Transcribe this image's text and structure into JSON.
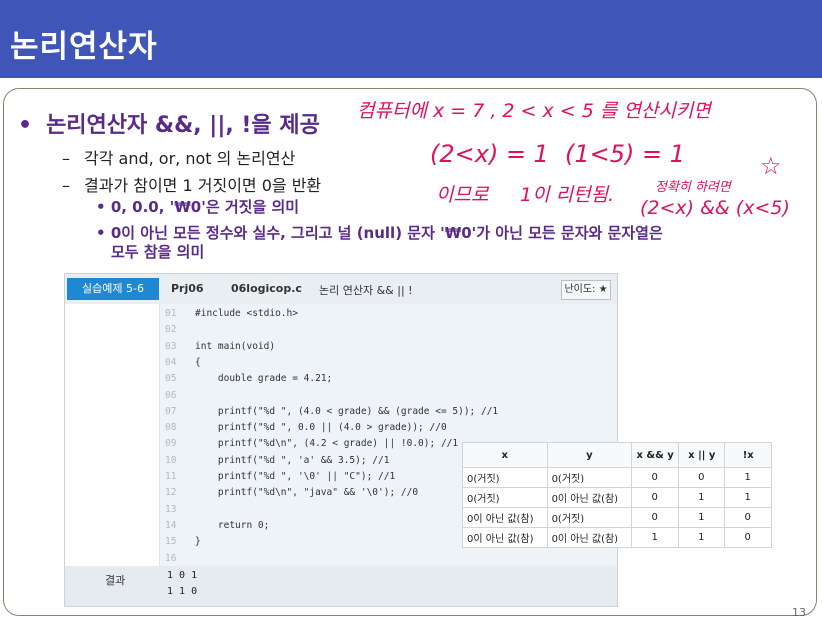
{
  "slide": {
    "title": "논리연산자",
    "bullet_main": "논리연산자 &&, ||, !을 제공",
    "sub_items": [
      "각각 and, or, not 의 논리연산",
      "결과가 참이면 1 거짓이면 0을 반환"
    ],
    "sub_sub_items": [
      "0, 0.0, '₩0'은 거짓을 의미",
      "0이 아닌 모든 정수와 실수, 그리고 널 (null) 문자 '₩0'가 아닌 모든 문자와 문자열은",
      "모두 참을 의미"
    ],
    "page_number": "13"
  },
  "annotations": {
    "line1": "컴퓨터에  x = 7 ,   2 < x < 5  를  연산시키면",
    "line2a": "(2<x) = 1",
    "line2b": "(1<5) = 1",
    "line3a": "이므로",
    "line3b": "1이 리턴됨.",
    "line3c": "정확히 하려면",
    "star": "☆",
    "line4": "(2<x) && (x<5)"
  },
  "code_panel": {
    "badge": "실습예제 5-6",
    "project": "Prj06",
    "filename": "06logicop.c",
    "description": "논리 연산자 && || !",
    "difficulty": "난이도: ★",
    "lines": [
      {
        "no": "01",
        "text": "#include <stdio.h>"
      },
      {
        "no": "02",
        "text": ""
      },
      {
        "no": "03",
        "text": "int main(void)"
      },
      {
        "no": "04",
        "text": "{"
      },
      {
        "no": "05",
        "text": "    double grade = 4.21;"
      },
      {
        "no": "06",
        "text": ""
      },
      {
        "no": "07",
        "text": "    printf(\"%d \", (4.0 < grade) && (grade <= 5)); //1"
      },
      {
        "no": "08",
        "text": "    printf(\"%d \", 0.0 || (4.0 > grade)); //0"
      },
      {
        "no": "09",
        "text": "    printf(\"%d\\n\", (4.2 < grade) || !0.0); //1"
      },
      {
        "no": "10",
        "text": "    printf(\"%d \", 'a' && 3.5); //1"
      },
      {
        "no": "11",
        "text": "    printf(\"%d \", '\\0' || \"C\"); //1"
      },
      {
        "no": "12",
        "text": "    printf(\"%d\\n\", \"java\" && '\\0'); //0"
      },
      {
        "no": "13",
        "text": ""
      },
      {
        "no": "14",
        "text": "    return 0;"
      },
      {
        "no": "15",
        "text": "}"
      },
      {
        "no": "16",
        "text": ""
      }
    ],
    "result_label": "결과",
    "result_lines": [
      "1 0 1",
      "1 1 0"
    ]
  },
  "truth_table": {
    "headers": [
      "x",
      "y",
      "x && y",
      "x || y",
      "!x"
    ],
    "rows": [
      [
        "0(거짓)",
        "0(거짓)",
        "0",
        "0",
        "1"
      ],
      [
        "0(거짓)",
        "0이 아닌 값(참)",
        "0",
        "1",
        "1"
      ],
      [
        "0이 아닌 값(참)",
        "0(거짓)",
        "0",
        "1",
        "0"
      ],
      [
        "0이 아닌 값(참)",
        "0이 아닌 값(참)",
        "1",
        "1",
        "0"
      ]
    ]
  },
  "colors": {
    "title_bar": "#3f55b7",
    "bullet_text": "#5a2a8a",
    "handwriting": "#e0105a",
    "code_badge": "#1f88d2"
  }
}
